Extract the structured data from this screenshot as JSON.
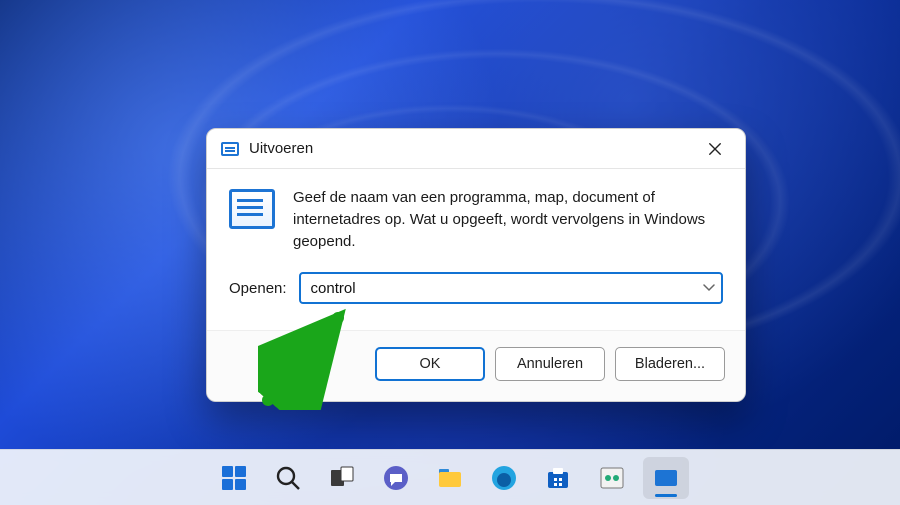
{
  "dialog": {
    "title": "Uitvoeren",
    "description": "Geef de naam van een programma, map, document of internetadres op. Wat u opgeeft, wordt vervolgens in Windows geopend.",
    "open_label": "Openen:",
    "open_value": "control",
    "buttons": {
      "ok": "OK",
      "cancel": "Annuleren",
      "browse": "Bladeren..."
    }
  },
  "taskbar": {
    "items": [
      {
        "name": "start",
        "active": false
      },
      {
        "name": "search",
        "active": false
      },
      {
        "name": "task-view",
        "active": false
      },
      {
        "name": "chat",
        "active": false
      },
      {
        "name": "explorer",
        "active": false
      },
      {
        "name": "edge",
        "active": false
      },
      {
        "name": "store",
        "active": false
      },
      {
        "name": "settings",
        "active": false
      },
      {
        "name": "run",
        "active": true
      }
    ]
  },
  "annotation": {
    "arrow_color": "#1aa61a"
  }
}
